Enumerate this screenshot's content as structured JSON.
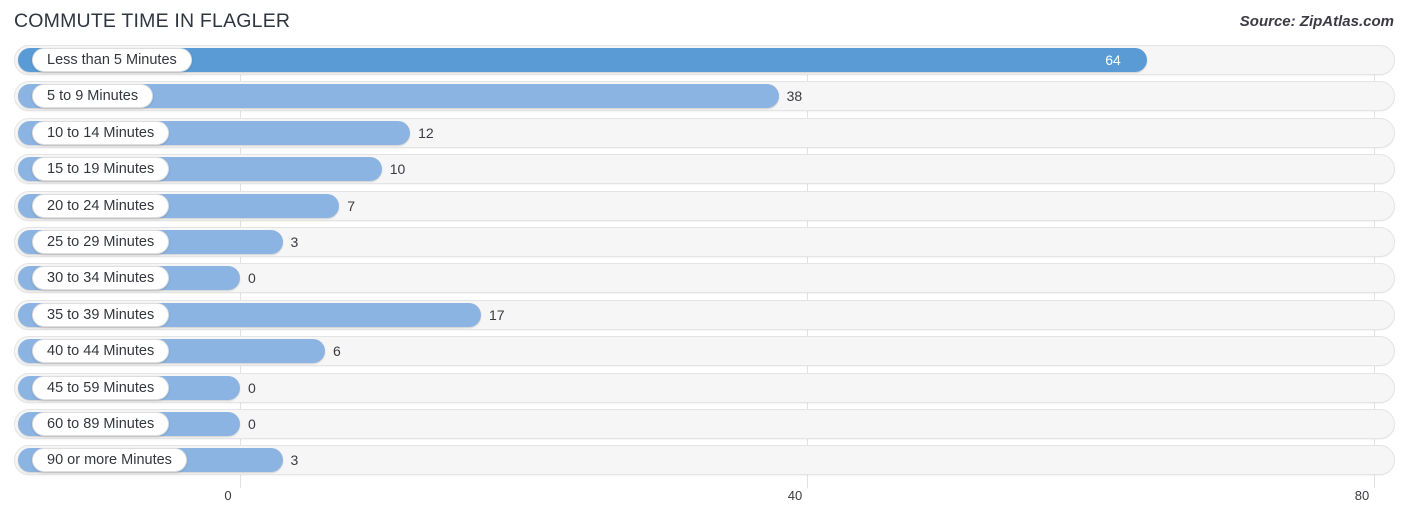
{
  "header": {
    "title": "COMMUTE TIME IN FLAGLER",
    "source": "Source: ZipAtlas.com"
  },
  "chart_data": {
    "type": "bar",
    "orientation": "horizontal",
    "title": "COMMUTE TIME IN FLAGLER",
    "xlabel": "",
    "ylabel": "",
    "xlim": [
      0,
      80
    ],
    "ticks": [
      0,
      40,
      80
    ],
    "tick_labels": [
      "0",
      "40",
      "80"
    ],
    "grid": true,
    "legend": false,
    "categories": [
      "Less than 5 Minutes",
      "5 to 9 Minutes",
      "10 to 14 Minutes",
      "15 to 19 Minutes",
      "20 to 24 Minutes",
      "25 to 29 Minutes",
      "30 to 34 Minutes",
      "35 to 39 Minutes",
      "40 to 44 Minutes",
      "45 to 59 Minutes",
      "60 to 89 Minutes",
      "90 or more Minutes"
    ],
    "values": [
      64,
      38,
      12,
      10,
      7,
      3,
      0,
      17,
      6,
      0,
      0,
      3
    ],
    "value_labels": [
      "64",
      "38",
      "12",
      "10",
      "7",
      "3",
      "0",
      "17",
      "6",
      "0",
      "0",
      "3"
    ],
    "colors": {
      "bar": "#8cb4e2",
      "bar_highlight": "#5b9bd5",
      "track": "#f6f6f6",
      "gridline": "#e2e2e2",
      "label_text": "#33373d"
    },
    "highlight_index": 0
  }
}
